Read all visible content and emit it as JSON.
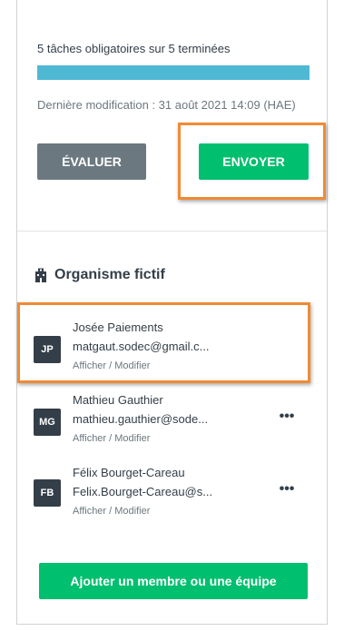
{
  "progress": {
    "label": "5 tâches obligatoires sur 5 terminées",
    "fraction": 1.0,
    "color": "#4fb9d4"
  },
  "last_modified": "Dernière modification : 31 août 2021 14:09 (HAE)",
  "actions": {
    "evaluate_label": "ÉVALUER",
    "send_label": "ENVOYER"
  },
  "organization": {
    "icon": "building-icon",
    "name": "Organisme fictif"
  },
  "members": [
    {
      "initials": "JP",
      "name": "Josée Paiements",
      "email": "matgaut.sodec@gmail.c...",
      "link": "Afficher / Modifier",
      "has_menu": false
    },
    {
      "initials": "MG",
      "name": "Mathieu Gauthier",
      "email": "mathieu.gauthier@sode...",
      "link": "Afficher / Modifier",
      "has_menu": true,
      "menu_icon": "more-options-icon"
    },
    {
      "initials": "FB",
      "name": "Félix Bourget-Careau",
      "email": "Felix.Bourget-Careau@s...",
      "link": "Afficher / Modifier",
      "has_menu": true,
      "menu_icon": "more-options-icon"
    }
  ],
  "add_member_label": "Ajouter un membre ou une équipe",
  "colors": {
    "primary_green": "#00bf6f",
    "secondary_gray": "#6b787f",
    "highlight_orange": "#f08b33",
    "avatar_dark": "#333e48"
  }
}
